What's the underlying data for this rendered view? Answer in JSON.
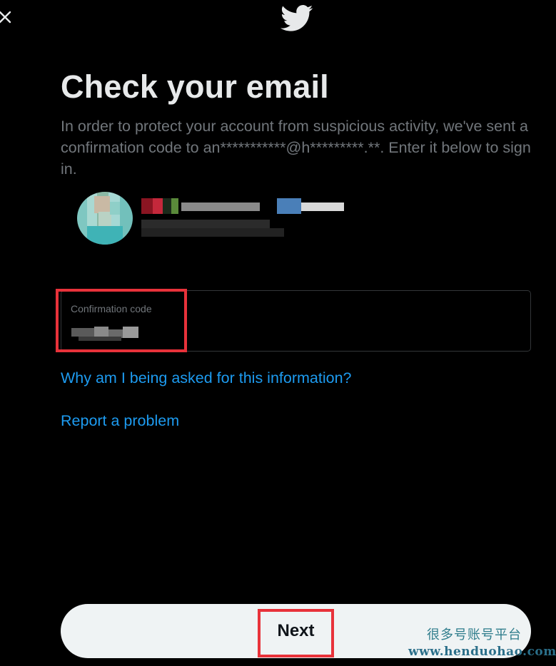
{
  "header": {
    "close_icon": "close-icon",
    "logo_icon": "twitter-bird-icon",
    "logo_color": "#e7e9ea"
  },
  "main": {
    "title": "Check your email",
    "description": "In order to protect your account from suspicious activity, we've sent a confirmation code to an***********@h*********.**. Enter it below to sign in."
  },
  "confirmation_field": {
    "label": "Confirmation code"
  },
  "links": {
    "why_asked": "Why am I being asked for this information?",
    "report_problem": "Report a problem"
  },
  "footer": {
    "next_label": "Next"
  },
  "watermark": {
    "chinese": "很多号账号平台",
    "url": "www.henduohao.com"
  },
  "colors": {
    "background": "#000000",
    "link": "#1d9bf0",
    "muted_text": "#71767b",
    "button_bg": "#eff3f4",
    "highlight": "#e8323a"
  }
}
